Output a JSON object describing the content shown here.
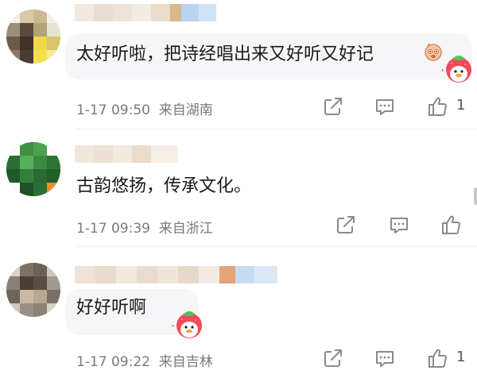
{
  "comments": [
    {
      "text": "太好听啦，把诗经唱出来又好听又好记",
      "date": "1-17 09:50",
      "location": "来自湖南",
      "like_count": "1"
    },
    {
      "text": "古韵悠扬，传承文化。",
      "date": "1-17 09:39",
      "location": "来自浙江",
      "like_count": ""
    },
    {
      "text": "好好听啊",
      "date": "1-17 09:22",
      "location": "来自吉林",
      "like_count": "1"
    }
  ],
  "icons": {
    "share": "share-icon",
    "reply": "reply-icon",
    "like": "thumbs-up-icon",
    "sticker": "strawberry-duck-sticker-icon",
    "emoji": "cute-face-emoji-icon"
  },
  "colors": {
    "bubble": "#f6f6f9",
    "meta_text": "#7a7a7a",
    "icon": "#8a8a8a"
  }
}
